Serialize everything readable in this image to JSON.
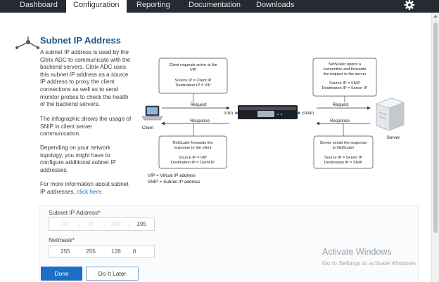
{
  "nav": {
    "tabs": [
      {
        "label": "Dashboard",
        "active": false
      },
      {
        "label": "Configuration",
        "active": true
      },
      {
        "label": "Reporting",
        "active": false
      },
      {
        "label": "Documentation",
        "active": false
      },
      {
        "label": "Downloads",
        "active": false
      }
    ],
    "settings_icon": "gear-icon"
  },
  "panel": {
    "title": "Subnet IP Address",
    "title_icon": "network-node-icon",
    "paragraphs": [
      "A subnet IP address is used by the Citrix ADC to communicate with the backend servers. Citrix ADC uses this subnet IP address as a source IP address to proxy the client connections as well as to send monitor probes to check the health of the backend servers.",
      "The infographic shows the usage of SNIP in client server communication.",
      "Depending on your network topology, you might have to configure additional subnet IP addresses."
    ],
    "more_info_prefix": "For more information about subnet IP addresses, ",
    "more_info_link": "click here",
    "more_info_suffix": "."
  },
  "diagram": {
    "client_label": "Client",
    "server_label": "Server",
    "vip_tag": "(VIP)",
    "snip_tag": "(SNIP)",
    "request_label_left": "Request",
    "response_label_left": "Response",
    "request_label_right": "Request",
    "response_label_right": "Response",
    "box_client_request": [
      "Client requests arrive at the",
      "VIP",
      "",
      "Source IP = Client IP",
      "Destination IP = VIP"
    ],
    "box_netscaler_open": [
      "NetScaler opens a",
      "connection and forwards",
      "the request to the server",
      "",
      "Source IP = SNIP",
      "Destination IP = Server IP"
    ],
    "box_netscaler_forward": [
      "NetScaler forwards the",
      "response to the client",
      "",
      "Source IP = VIP",
      "Destination IP = Client IP"
    ],
    "box_server_send": [
      "Server sends the response",
      "to NetScaler",
      "",
      "Source IP = Server IP",
      "Destination IP = SNIP"
    ],
    "legend": [
      "VIP = Virtual IP address",
      "SNIP = Subnet IP address"
    ]
  },
  "form": {
    "subnet_label": "Subnet IP Address*",
    "subnet_octets": [
      "10",
      "0",
      "100",
      "195"
    ],
    "netmask_label": "Netmask*",
    "netmask_octets": [
      "255",
      "255",
      "128",
      "0"
    ],
    "done_button": "Done",
    "later_button": "Do It Later"
  },
  "activation_notice": {
    "title": "Activate Windows",
    "subtitle": "Go to Settings to activate Windows."
  },
  "colors": {
    "nav_bg": "#252a33",
    "title": "#1f5a8c",
    "link": "#1a73c4",
    "primary_button": "#1b70c3"
  }
}
